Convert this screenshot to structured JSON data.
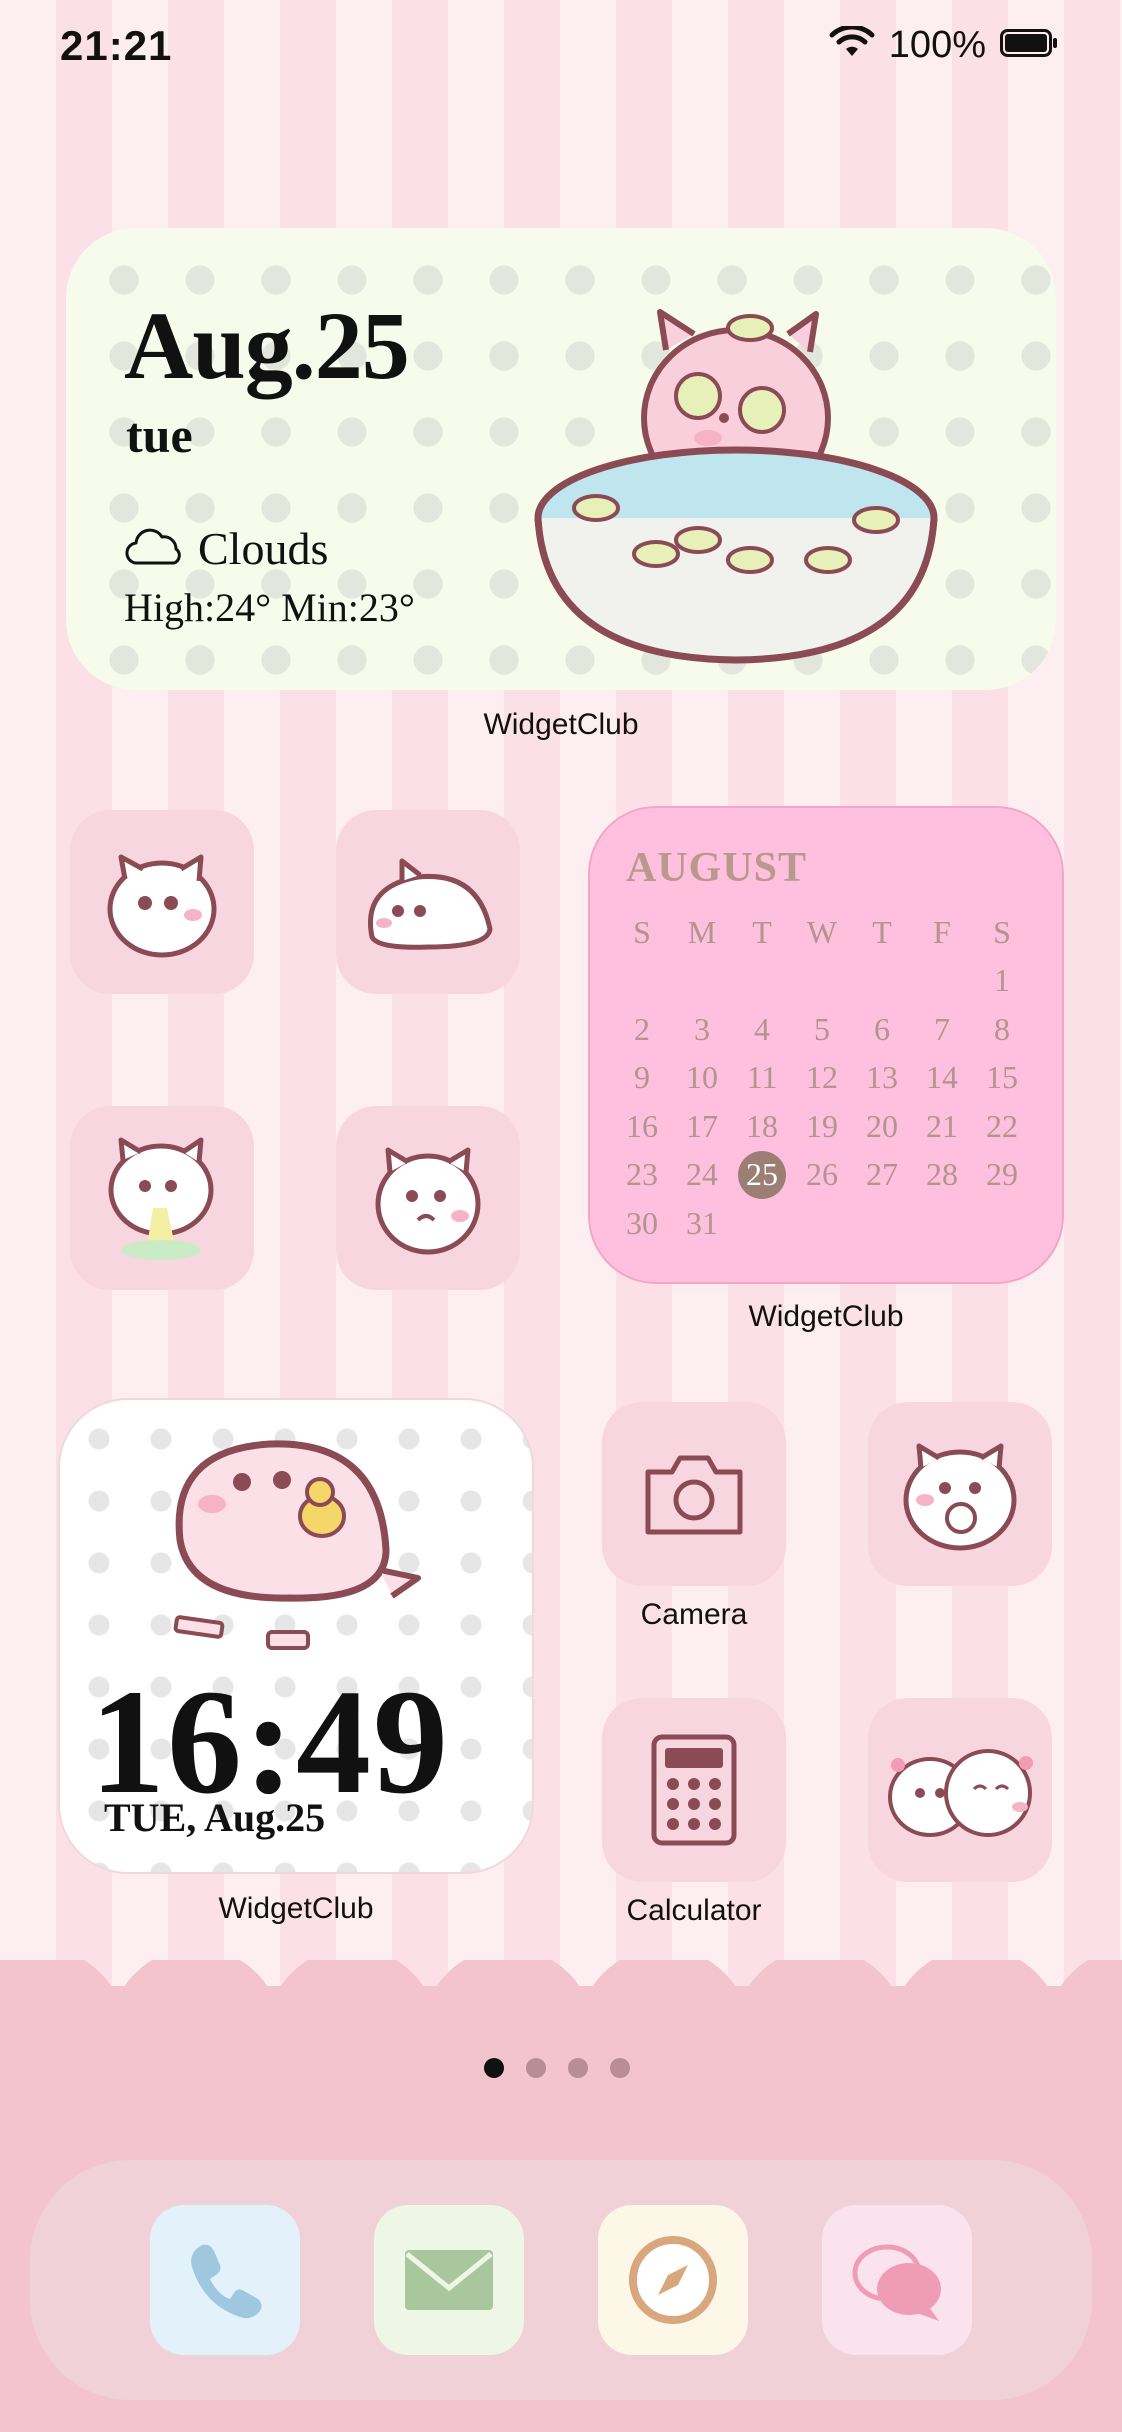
{
  "status_bar": {
    "time": "21:21",
    "battery": "100%"
  },
  "weather_widget": {
    "date": "Aug.25",
    "day": "tue",
    "condition": "Clouds",
    "temps": "High:24° Min:23°",
    "label": "WidgetClub"
  },
  "calendar_widget": {
    "month": "AUGUST",
    "weekdays": [
      "S",
      "M",
      "T",
      "W",
      "T",
      "F",
      "S"
    ],
    "days": [
      "",
      "",
      "",
      "",
      "",
      "",
      "1",
      "2",
      "3",
      "4",
      "5",
      "6",
      "7",
      "8",
      "9",
      "10",
      "11",
      "12",
      "13",
      "14",
      "15",
      "16",
      "17",
      "18",
      "19",
      "20",
      "21",
      "22",
      "23",
      "24",
      "25",
      "26",
      "27",
      "28",
      "29",
      "30",
      "31",
      "",
      "",
      "",
      "",
      ""
    ],
    "today": "25",
    "label": "WidgetClub"
  },
  "clock_widget": {
    "time": "16:49",
    "date": "TUE, Aug.25",
    "label": "WidgetClub"
  },
  "apps": {
    "camera": "Camera",
    "calculator": "Calculator"
  },
  "page_dots": {
    "count": 4,
    "active": 0
  },
  "dock": {
    "icons": [
      "phone-icon",
      "mail-icon",
      "safari-icon",
      "messages-icon"
    ]
  },
  "colors": {
    "background_stripe_light": "#fdeef1",
    "background_stripe_dark": "#fbe1e7",
    "calendar_bg": "#ffbfdf",
    "today_circle": "#9c7f74",
    "icon_bg": "#f8d6e0",
    "bottom_area": "#f3c3ce"
  }
}
